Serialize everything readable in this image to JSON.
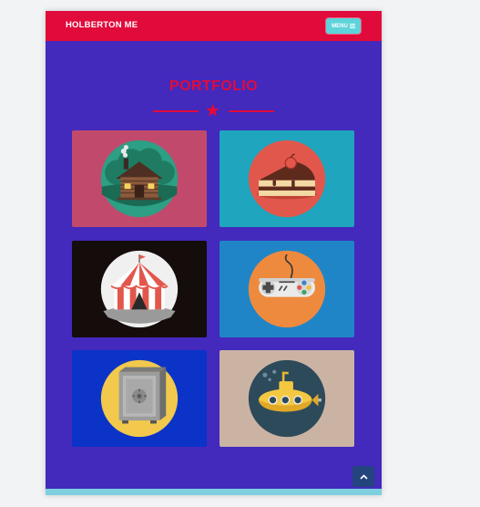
{
  "nav": {
    "brand": "HOLBERTON ME",
    "menu_label": "MENU"
  },
  "portfolio": {
    "title": "PORTFOLIO",
    "items": [
      {
        "icon": "log-cabin-icon",
        "background": "#c14a6c"
      },
      {
        "icon": "cake-slice-icon",
        "background": "#1fa5be"
      },
      {
        "icon": "circus-tent-icon",
        "background": "#150c0c"
      },
      {
        "icon": "game-controller-icon",
        "background": "#1f85c7"
      },
      {
        "icon": "safe-icon",
        "background": "#0b33c7"
      },
      {
        "icon": "submarine-icon",
        "background": "#cbb3a4"
      }
    ]
  },
  "colors": {
    "primary": "#e10b3b",
    "page_background": "#4329bc",
    "accent": "#5ed3da",
    "scroll_button": "#24447d"
  }
}
